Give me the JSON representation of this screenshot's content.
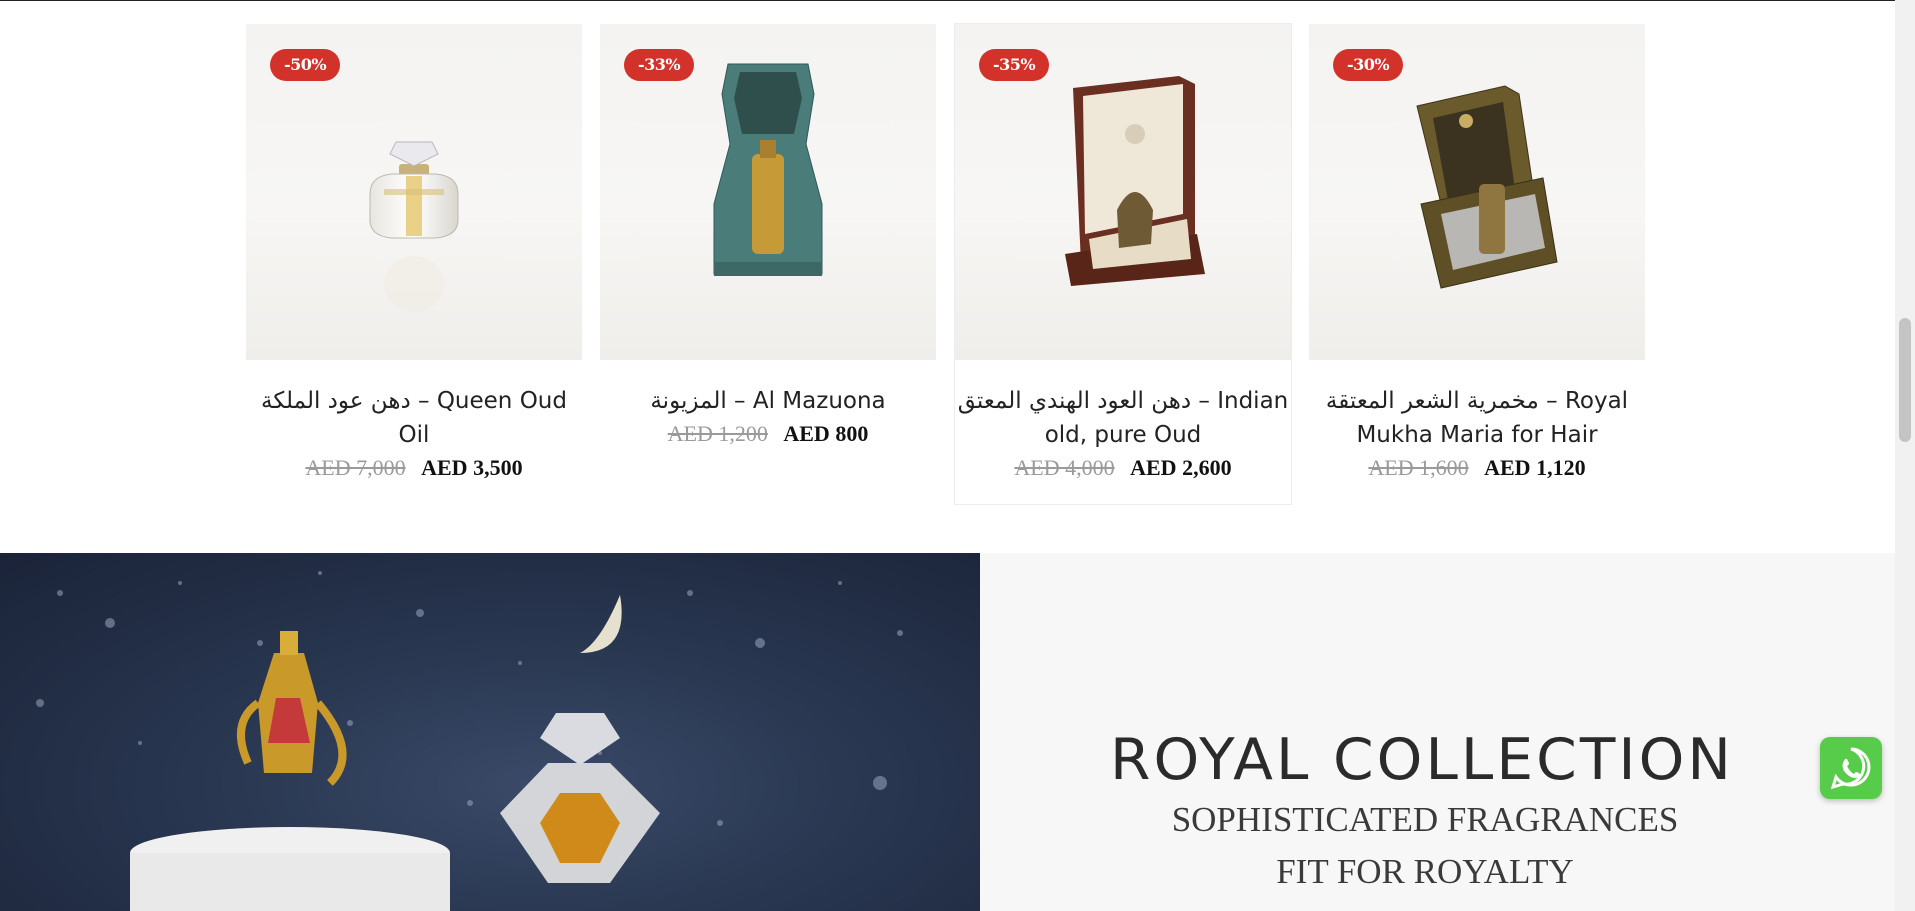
{
  "products": [
    {
      "discount": "-50%",
      "title": "دهن عود الملكة – Queen Oud Oil",
      "old_price": "AED 7,000",
      "new_price": "AED 3,500",
      "image": "crystal-perfume-bottle"
    },
    {
      "discount": "-33%",
      "title": "المزيونة – Al Mazuona",
      "old_price": "AED 1,200",
      "new_price": "AED 800",
      "image": "teal-octagon-box-bottle"
    },
    {
      "discount": "-35%",
      "title": "دهن العود الهندي المعتق – Indian old, pure Oud",
      "old_price": "AED 4,000",
      "new_price": "AED 2,600",
      "image": "wooden-box-gold-bottle"
    },
    {
      "discount": "-30%",
      "title": "مخمرية الشعر المعتقة – Royal Mukha Maria for Hair",
      "old_price": "AED 1,600",
      "new_price": "AED 1,120",
      "image": "gold-box-bottle"
    }
  ],
  "banner": {
    "title": "ROYAL COLLECTION",
    "subtitle_line1": "SOPHISTICATED FRAGRANCES",
    "subtitle_line2": "FIT FOR ROYALTY",
    "image": "night-sky-dallah-perfume"
  },
  "whatsapp": {
    "icon": "whatsapp-icon"
  },
  "colors": {
    "badge": "#d3322a",
    "banner_bg": "#2a3852",
    "whatsapp": "#57cc4b"
  }
}
